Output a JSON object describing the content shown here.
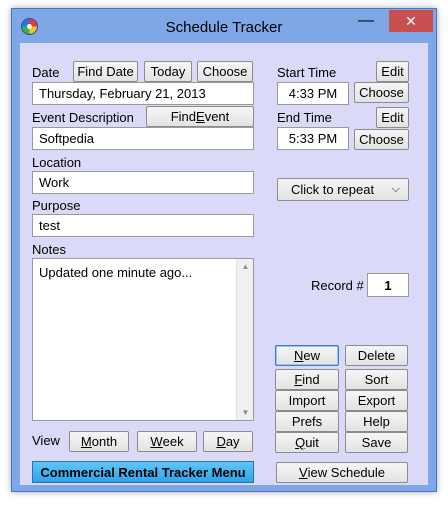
{
  "window": {
    "title": "Schedule Tracker",
    "minimize_glyph": "—",
    "maximize_glyph": "☐",
    "close_glyph": "✕"
  },
  "date": {
    "label": "Date",
    "find_date_label": "Find Date",
    "today_label": "Today",
    "choose_label": "Choose",
    "value": "Thursday, February 21, 2013"
  },
  "event": {
    "label": "Event Description",
    "find_event_pre": "Find ",
    "find_event_key": "E",
    "find_event_post": "vent",
    "value": "Softpedia"
  },
  "location": {
    "label": "Location",
    "value": "Work"
  },
  "purpose": {
    "label": "Purpose",
    "value": "test"
  },
  "notes": {
    "label": "Notes",
    "value": "Updated one minute ago..."
  },
  "start_time": {
    "label": "Start Time",
    "edit_label": "Edit",
    "choose_label": "Choose",
    "value": "4:33 PM"
  },
  "end_time": {
    "label": "End Time",
    "edit_label": "Edit",
    "choose_label": "Choose",
    "value": "5:33 PM"
  },
  "repeat": {
    "selected": "Click to repeat"
  },
  "record": {
    "label": "Record #",
    "value": "1"
  },
  "actions": {
    "new_key": "N",
    "new_rest": "ew",
    "delete_label": "Delete",
    "find_key": "F",
    "find_rest": "ind",
    "sort_label": "Sort",
    "import_label": "Import",
    "export_label": "Export",
    "prefs_label": "Prefs",
    "help_label": "Help",
    "quit_key": "Q",
    "quit_rest": "uit",
    "save_label": "Save"
  },
  "view": {
    "label": "View",
    "month_key": "M",
    "month_rest": "onth",
    "week_key": "W",
    "week_rest": "eek",
    "day_key": "D",
    "day_rest": "ay"
  },
  "bottom": {
    "menu_label": "Commercial Rental Tracker Menu",
    "view_schedule_key": "V",
    "view_schedule_rest": "iew Schedule"
  }
}
